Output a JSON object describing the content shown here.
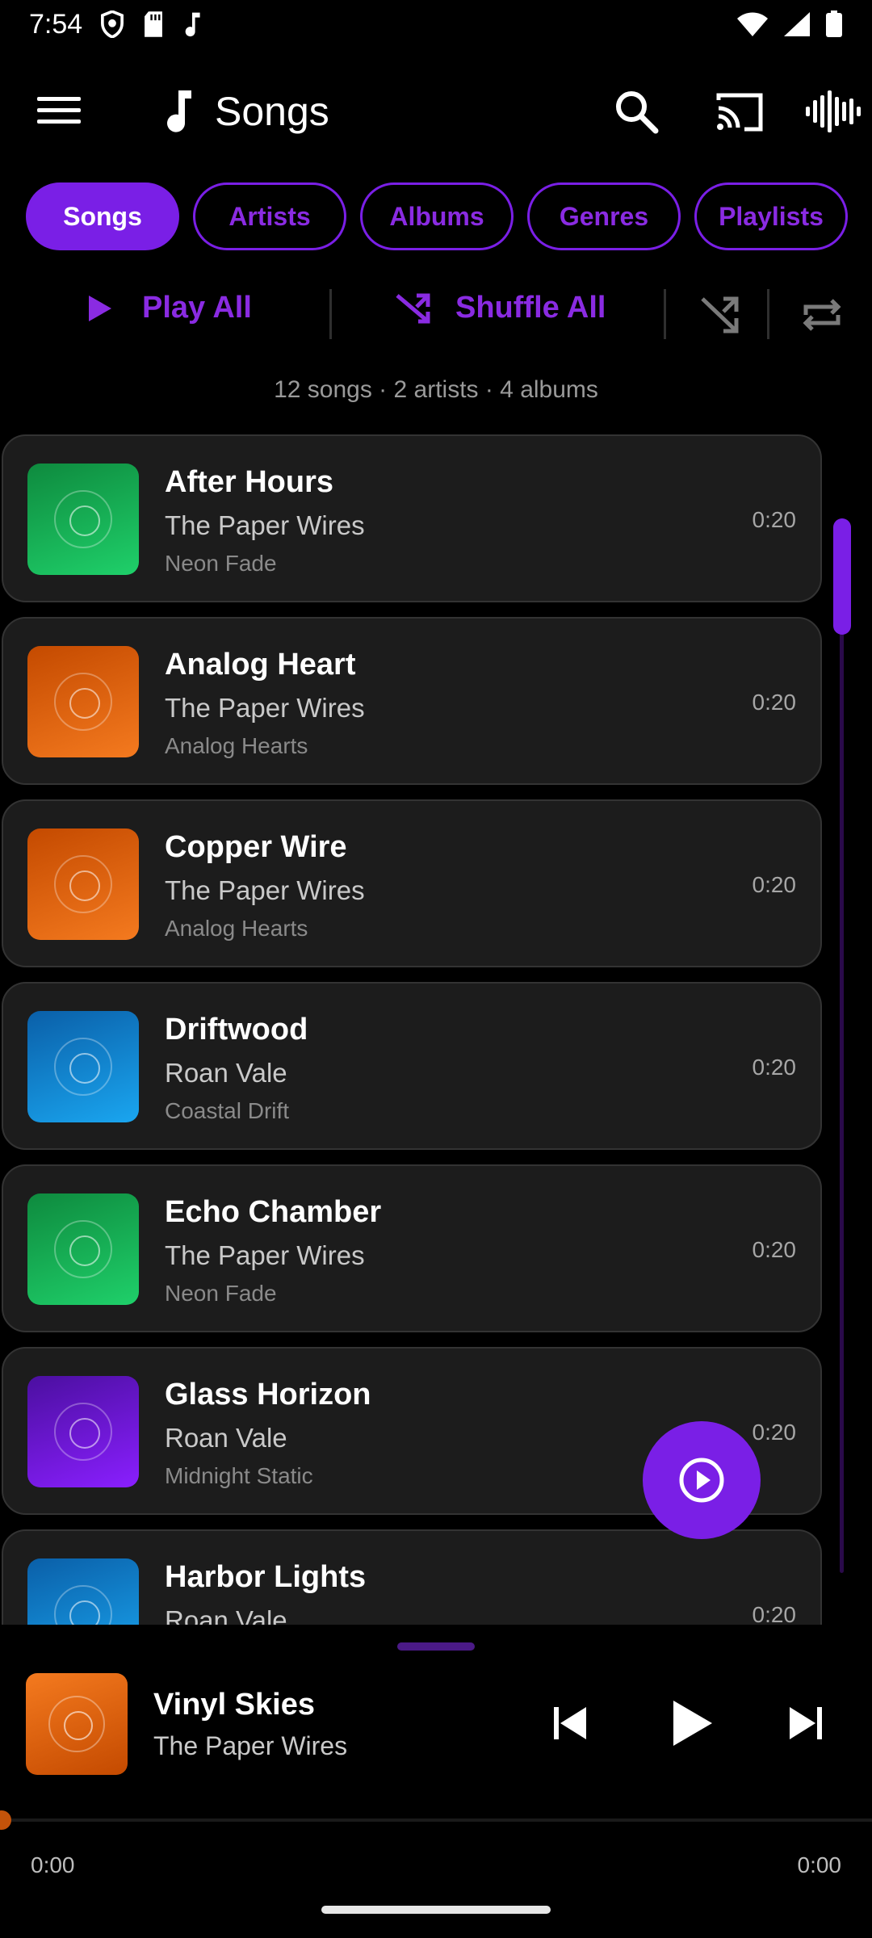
{
  "status_bar": {
    "time": "7:54"
  },
  "app_bar": {
    "title": "Songs"
  },
  "tabs": [
    {
      "label": "Songs",
      "active": true
    },
    {
      "label": "Artists",
      "active": false
    },
    {
      "label": "Albums",
      "active": false
    },
    {
      "label": "Genres",
      "active": false
    },
    {
      "label": "Playlists",
      "active": false
    }
  ],
  "actions": {
    "play_all": "Play All",
    "shuffle_all": "Shuffle All"
  },
  "summary": "12 songs  ·  2 artists  ·  4 albums",
  "songs": [
    {
      "title": "After Hours",
      "artist": "The Paper Wires",
      "album": "Neon Fade",
      "duration": "0:20",
      "art": "green"
    },
    {
      "title": "Analog Heart",
      "artist": "The Paper Wires",
      "album": "Analog Hearts",
      "duration": "0:20",
      "art": "orange"
    },
    {
      "title": "Copper Wire",
      "artist": "The Paper Wires",
      "album": "Analog Hearts",
      "duration": "0:20",
      "art": "orange"
    },
    {
      "title": "Driftwood",
      "artist": "Roan Vale",
      "album": "Coastal Drift",
      "duration": "0:20",
      "art": "blue"
    },
    {
      "title": "Echo Chamber",
      "artist": "The Paper Wires",
      "album": "Neon Fade",
      "duration": "0:20",
      "art": "green"
    },
    {
      "title": "Glass Horizon",
      "artist": "Roan Vale",
      "album": "Midnight Static",
      "duration": "0:20",
      "art": "purple"
    },
    {
      "title": "Harbor Lights",
      "artist": "Roan Vale",
      "album": "",
      "duration": "0:20",
      "art": "blue"
    }
  ],
  "now_playing": {
    "title": "Vinyl Skies",
    "artist": "The Paper Wires",
    "time_elapsed": "0:00",
    "time_total": "0:00",
    "progress": 0
  },
  "colors": {
    "accent": "#7a1fe6",
    "background": "#000000",
    "card": "#1c1c1c",
    "art_green": [
      "#1fd06a",
      "#0e8a3e"
    ],
    "art_orange": [
      "#f47a1f",
      "#c44a00"
    ],
    "art_blue": [
      "#1aa6f0",
      "#0a5fa8"
    ],
    "art_purple": [
      "#8a1fff",
      "#4b0fa0"
    ]
  },
  "icons": {
    "menu": "menu-icon",
    "title": "music-note-icon",
    "search": "search-icon",
    "cast": "cast-icon",
    "visualizer": "waveform-icon",
    "play": "play-icon",
    "shuffle": "shuffle-icon",
    "repeat": "repeat-icon",
    "fab": "play-circle-icon",
    "prev": "skip-previous-icon",
    "next": "skip-next-icon"
  }
}
